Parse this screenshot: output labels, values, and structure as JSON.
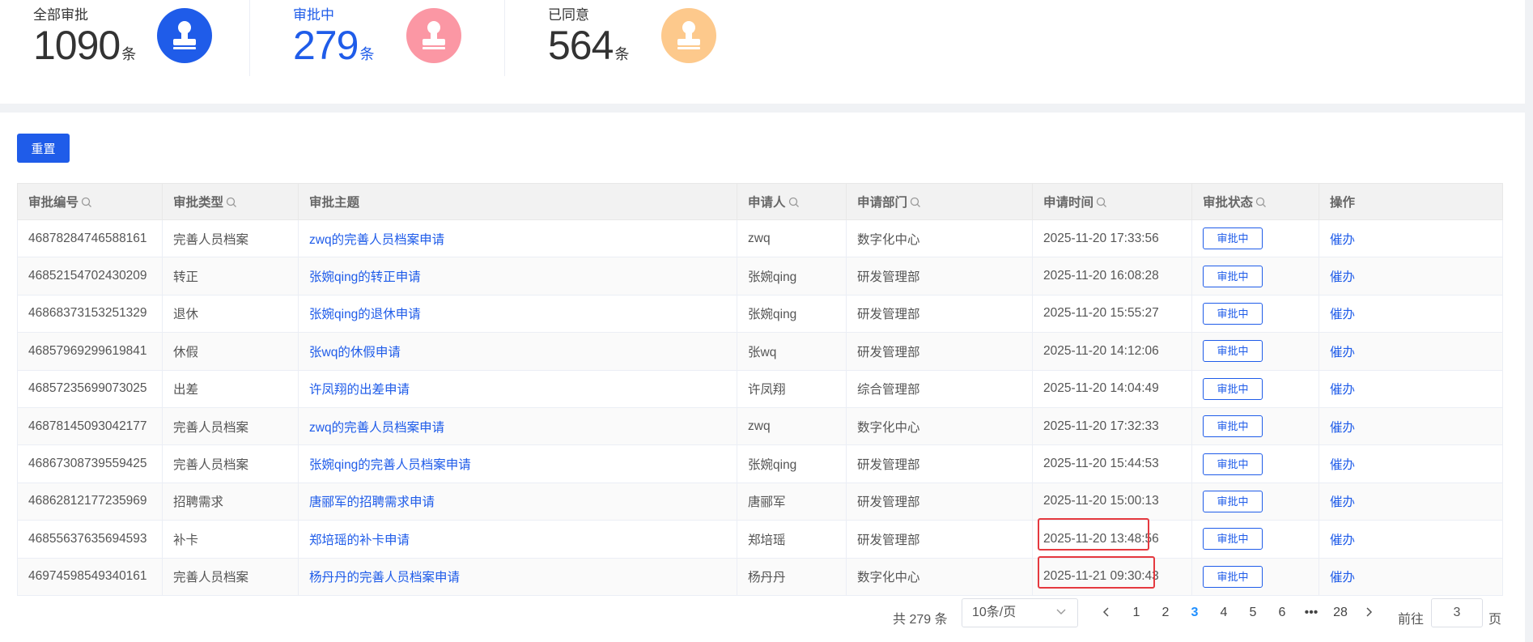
{
  "stats": [
    {
      "label": "全部审批",
      "count": "1090",
      "unit": "条",
      "color": "#1f5ce9"
    },
    {
      "label": "审批中",
      "count": "279",
      "unit": "条",
      "color": "#fb97a4"
    },
    {
      "label": "已同意",
      "count": "564",
      "unit": "条",
      "color": "#fdc98c"
    }
  ],
  "toolbar": {
    "reset_label": "重置"
  },
  "table": {
    "columns": [
      "审批编号",
      "审批类型",
      "审批主题",
      "申请人",
      "申请部门",
      "申请时间",
      "审批状态",
      "操作"
    ],
    "rows": [
      {
        "id": "46878284746588161",
        "type": "完善人员档案",
        "subject": "zwq的完善人员档案申请",
        "applicant": "zwq",
        "dept": "数字化中心",
        "time": "2025-11-20 17:33:56",
        "status": "审批中",
        "action": "催办"
      },
      {
        "id": "46852154702430209",
        "type": "转正",
        "subject": "张婉qing的转正申请",
        "applicant": "张婉qing",
        "dept": "研发管理部",
        "time": "2025-11-20 16:08:28",
        "status": "审批中",
        "action": "催办"
      },
      {
        "id": "46868373153251329",
        "type": "退休",
        "subject": "张婉qing的退休申请",
        "applicant": "张婉qing",
        "dept": "研发管理部",
        "time": "2025-11-20 15:55:27",
        "status": "审批中",
        "action": "催办"
      },
      {
        "id": "46857969299619841",
        "type": "休假",
        "subject": "张wq的休假申请",
        "applicant": "张wq",
        "dept": "研发管理部",
        "time": "2025-11-20 14:12:06",
        "status": "审批中",
        "action": "催办"
      },
      {
        "id": "46857235699073025",
        "type": "出差",
        "subject": "许凤翔的出差申请",
        "applicant": "许凤翔",
        "dept": "综合管理部",
        "time": "2025-11-20 14:04:49",
        "status": "审批中",
        "action": "催办"
      },
      {
        "id": "46878145093042177",
        "type": "完善人员档案",
        "subject": "zwq的完善人员档案申请",
        "applicant": "zwq",
        "dept": "数字化中心",
        "time": "2025-11-20 17:32:33",
        "status": "审批中",
        "action": "催办"
      },
      {
        "id": "46867308739559425",
        "type": "完善人员档案",
        "subject": "张婉qing的完善人员档案申请",
        "applicant": "张婉qing",
        "dept": "研发管理部",
        "time": "2025-11-20 15:44:53",
        "status": "审批中",
        "action": "催办"
      },
      {
        "id": "46862812177235969",
        "type": "招聘需求",
        "subject": "唐郦军的招聘需求申请",
        "applicant": "唐郦军",
        "dept": "研发管理部",
        "time": "2025-11-20 15:00:13",
        "status": "审批中",
        "action": "催办"
      },
      {
        "id": "46855637635694593",
        "type": "补卡",
        "subject": "郑培瑶的补卡申请",
        "applicant": "郑培瑶",
        "dept": "研发管理部",
        "time": "2025-11-20 13:48:56",
        "status": "审批中",
        "action": "催办",
        "highlight": true
      },
      {
        "id": "46974598549340161",
        "type": "完善人员档案",
        "subject": "杨丹丹的完善人员档案申请",
        "applicant": "杨丹丹",
        "dept": "数字化中心",
        "time": "2025-11-21 09:30:43",
        "status": "审批中",
        "action": "催办",
        "highlight": true
      }
    ]
  },
  "pagination": {
    "total": "共 279 条",
    "page_size": "10条/页",
    "pages": [
      "1",
      "2",
      "3",
      "4",
      "5",
      "6",
      "•••",
      "28"
    ],
    "current": "3",
    "goto_label": "前往",
    "goto_value": "3",
    "page_suffix": "页"
  },
  "colors": {
    "primary": "#1f5ce9",
    "highlight": "#e5393f"
  }
}
